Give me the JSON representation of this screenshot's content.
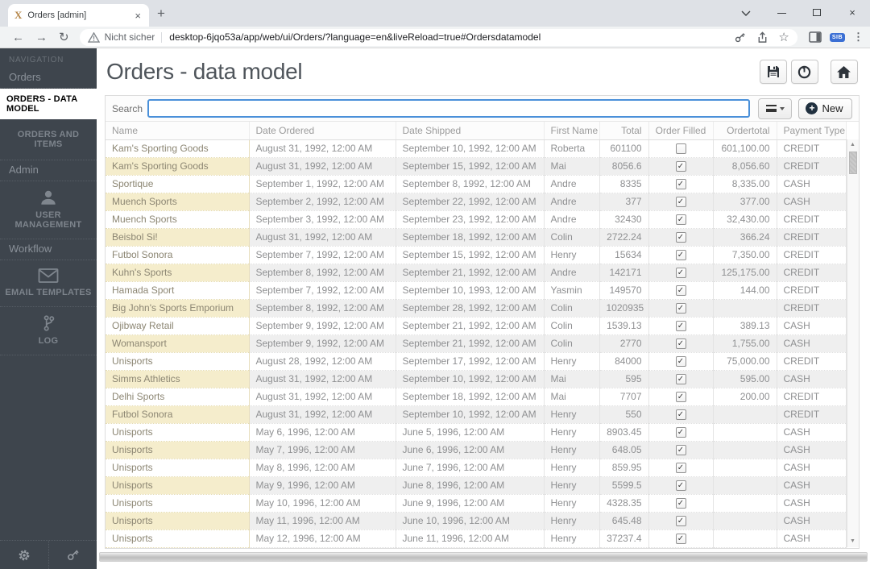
{
  "browser": {
    "tab_title": "Orders [admin]",
    "security_label": "Nicht sicher",
    "url": "desktop-6jqo53a/app/web/ui/Orders/?language=en&liveReload=true#Ordersdatamodel",
    "extension_badge": "SIB"
  },
  "icons": {
    "back": "←",
    "forward": "→",
    "reload": "↻",
    "star": "☆",
    "menu_dots": "⋮",
    "tab_close": "×",
    "new_tab": "+",
    "window_close": "×",
    "scroll_up": "▲",
    "scroll_down": "▼",
    "check": "✓",
    "plus": "+"
  },
  "sidebar": {
    "nav_label": "NAVIGATION",
    "section_orders": "Orders",
    "item_orders_data_model": "ORDERS - DATA MODEL",
    "item_orders_and_items": "ORDERS AND ITEMS",
    "section_admin": "Admin",
    "item_user_management": "USER MANAGEMENT",
    "section_workflow": "Workflow",
    "item_email_templates": "EMAIL TEMPLATES",
    "item_log": "LOG"
  },
  "header": {
    "title": "Orders - data model"
  },
  "toolbar": {
    "search_label": "Search",
    "search_value": "",
    "new_label": "New"
  },
  "table": {
    "columns": [
      "Name",
      "Date Ordered",
      "Date Shipped",
      "First Name",
      "Total",
      "Order Filled",
      "Ordertotal",
      "Payment Type"
    ],
    "rows": [
      {
        "name": "Kam's Sporting Goods",
        "date_ordered": "August 31, 1992, 12:00 AM",
        "date_shipped": "September 10, 1992, 12:00 AM",
        "first_name": "Roberta",
        "total": "601100",
        "order_filled": false,
        "ordertotal": "601,100.00",
        "payment_type": "CREDIT"
      },
      {
        "name": "Kam's Sporting Goods",
        "date_ordered": "August 31, 1992, 12:00 AM",
        "date_shipped": "September 15, 1992, 12:00 AM",
        "first_name": "Mai",
        "total": "8056.6",
        "order_filled": true,
        "ordertotal": "8,056.60",
        "payment_type": "CREDIT"
      },
      {
        "name": "Sportique",
        "date_ordered": "September 1, 1992, 12:00 AM",
        "date_shipped": "September 8, 1992, 12:00 AM",
        "first_name": "Andre",
        "total": "8335",
        "order_filled": true,
        "ordertotal": "8,335.00",
        "payment_type": "CASH"
      },
      {
        "name": "Muench Sports",
        "date_ordered": "September 2, 1992, 12:00 AM",
        "date_shipped": "September 22, 1992, 12:00 AM",
        "first_name": "Andre",
        "total": "377",
        "order_filled": true,
        "ordertotal": "377.00",
        "payment_type": "CASH"
      },
      {
        "name": "Muench Sports",
        "date_ordered": "September 3, 1992, 12:00 AM",
        "date_shipped": "September 23, 1992, 12:00 AM",
        "first_name": "Andre",
        "total": "32430",
        "order_filled": true,
        "ordertotal": "32,430.00",
        "payment_type": "CREDIT"
      },
      {
        "name": "Beisbol Si!",
        "date_ordered": "August 31, 1992, 12:00 AM",
        "date_shipped": "September 18, 1992, 12:00 AM",
        "first_name": "Colin",
        "total": "2722.24",
        "order_filled": true,
        "ordertotal": "366.24",
        "payment_type": "CREDIT"
      },
      {
        "name": "Futbol Sonora",
        "date_ordered": "September 7, 1992, 12:00 AM",
        "date_shipped": "September 15, 1992, 12:00 AM",
        "first_name": "Henry",
        "total": "15634",
        "order_filled": true,
        "ordertotal": "7,350.00",
        "payment_type": "CREDIT"
      },
      {
        "name": "Kuhn's Sports",
        "date_ordered": "September 8, 1992, 12:00 AM",
        "date_shipped": "September 21, 1992, 12:00 AM",
        "first_name": "Andre",
        "total": "142171",
        "order_filled": true,
        "ordertotal": "125,175.00",
        "payment_type": "CREDIT"
      },
      {
        "name": "Hamada Sport",
        "date_ordered": "September 7, 1992, 12:00 AM",
        "date_shipped": "September 10, 1993, 12:00 AM",
        "first_name": "Yasmin",
        "total": "149570",
        "order_filled": true,
        "ordertotal": "144.00",
        "payment_type": "CREDIT"
      },
      {
        "name": "Big John's Sports Emporium",
        "date_ordered": "September 8, 1992, 12:00 AM",
        "date_shipped": "September 28, 1992, 12:00 AM",
        "first_name": "Colin",
        "total": "1020935",
        "order_filled": true,
        "ordertotal": "",
        "payment_type": "CREDIT"
      },
      {
        "name": "Ojibway Retail",
        "date_ordered": "September 9, 1992, 12:00 AM",
        "date_shipped": "September 21, 1992, 12:00 AM",
        "first_name": "Colin",
        "total": "1539.13",
        "order_filled": true,
        "ordertotal": "389.13",
        "payment_type": "CASH"
      },
      {
        "name": "Womansport",
        "date_ordered": "September 9, 1992, 12:00 AM",
        "date_shipped": "September 21, 1992, 12:00 AM",
        "first_name": "Colin",
        "total": "2770",
        "order_filled": true,
        "ordertotal": "1,755.00",
        "payment_type": "CASH"
      },
      {
        "name": "Unisports",
        "date_ordered": "August 28, 1992, 12:00 AM",
        "date_shipped": "September 17, 1992, 12:00 AM",
        "first_name": "Henry",
        "total": "84000",
        "order_filled": true,
        "ordertotal": "75,000.00",
        "payment_type": "CREDIT"
      },
      {
        "name": "Simms Athletics",
        "date_ordered": "August 31, 1992, 12:00 AM",
        "date_shipped": "September 10, 1992, 12:00 AM",
        "first_name": "Mai",
        "total": "595",
        "order_filled": true,
        "ordertotal": "595.00",
        "payment_type": "CASH"
      },
      {
        "name": "Delhi Sports",
        "date_ordered": "August 31, 1992, 12:00 AM",
        "date_shipped": "September 18, 1992, 12:00 AM",
        "first_name": "Mai",
        "total": "7707",
        "order_filled": true,
        "ordertotal": "200.00",
        "payment_type": "CREDIT"
      },
      {
        "name": "Futbol Sonora",
        "date_ordered": "August 31, 1992, 12:00 AM",
        "date_shipped": "September 10, 1992, 12:00 AM",
        "first_name": "Henry",
        "total": "550",
        "order_filled": true,
        "ordertotal": "",
        "payment_type": "CREDIT"
      },
      {
        "name": "Unisports",
        "date_ordered": "May 6, 1996, 12:00 AM",
        "date_shipped": "June 5, 1996, 12:00 AM",
        "first_name": "Henry",
        "total": "8903.45",
        "order_filled": true,
        "ordertotal": "",
        "payment_type": "CASH"
      },
      {
        "name": "Unisports",
        "date_ordered": "May 7, 1996, 12:00 AM",
        "date_shipped": "June 6, 1996, 12:00 AM",
        "first_name": "Henry",
        "total": "648.05",
        "order_filled": true,
        "ordertotal": "",
        "payment_type": "CASH"
      },
      {
        "name": "Unisports",
        "date_ordered": "May 8, 1996, 12:00 AM",
        "date_shipped": "June 7, 1996, 12:00 AM",
        "first_name": "Henry",
        "total": "859.95",
        "order_filled": true,
        "ordertotal": "",
        "payment_type": "CASH"
      },
      {
        "name": "Unisports",
        "date_ordered": "May 9, 1996, 12:00 AM",
        "date_shipped": "June 8, 1996, 12:00 AM",
        "first_name": "Henry",
        "total": "5599.5",
        "order_filled": true,
        "ordertotal": "",
        "payment_type": "CASH"
      },
      {
        "name": "Unisports",
        "date_ordered": "May 10, 1996, 12:00 AM",
        "date_shipped": "June 9, 1996, 12:00 AM",
        "first_name": "Henry",
        "total": "4328.35",
        "order_filled": true,
        "ordertotal": "",
        "payment_type": "CASH"
      },
      {
        "name": "Unisports",
        "date_ordered": "May 11, 1996, 12:00 AM",
        "date_shipped": "June 10, 1996, 12:00 AM",
        "first_name": "Henry",
        "total": "645.48",
        "order_filled": true,
        "ordertotal": "",
        "payment_type": "CASH"
      },
      {
        "name": "Unisports",
        "date_ordered": "May 12, 1996, 12:00 AM",
        "date_shipped": "June 11, 1996, 12:00 AM",
        "first_name": "Henry",
        "total": "37237.4",
        "order_filled": true,
        "ordertotal": "",
        "payment_type": "CASH"
      }
    ]
  },
  "colors": {
    "accent_blue": "#4a90d9",
    "name_cell_bg": "#fcf5da",
    "sidebar_bg": "#3e454d",
    "favicon_gold": "#b5874b",
    "extension_badge_bg": "#3b6fd4"
  }
}
